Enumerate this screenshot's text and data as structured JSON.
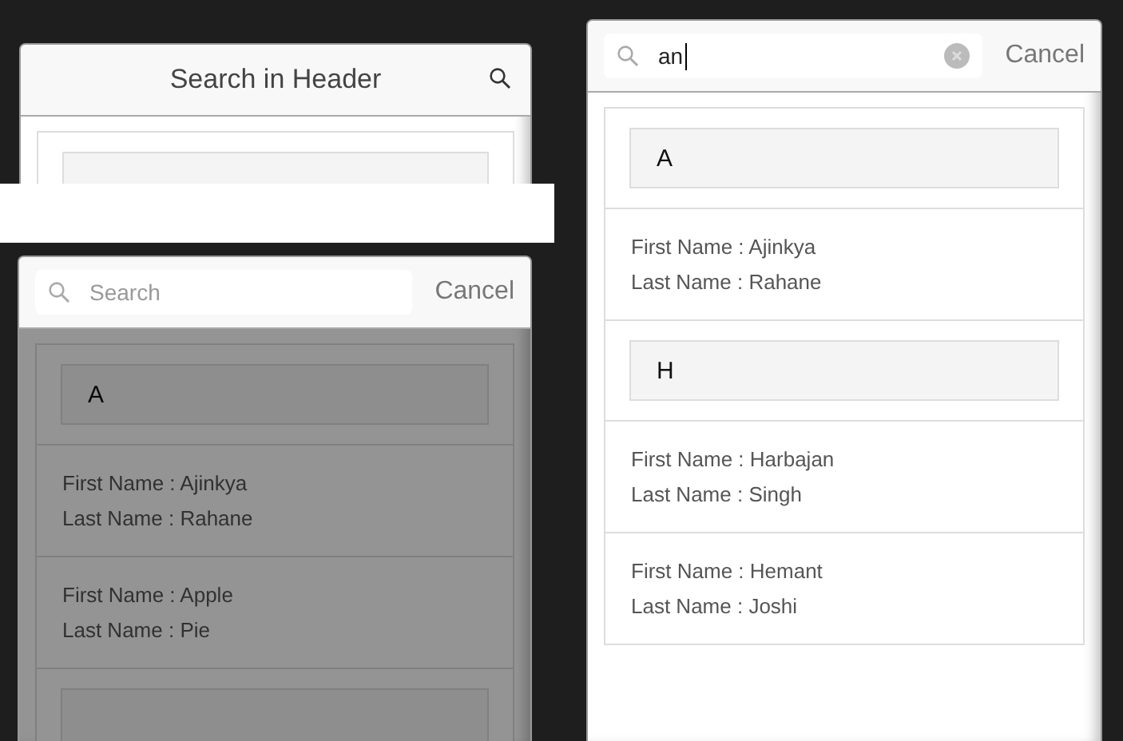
{
  "panels": [
    {
      "kind": "header",
      "title": "Search in Header",
      "list": [
        {
          "kind": "divider"
        }
      ]
    },
    {
      "kind": "search",
      "search": {
        "placeholder": "Search",
        "focused": false
      },
      "cancel": "Cancel",
      "dimmed": true,
      "list": [
        {
          "kind": "divider",
          "label": "A"
        },
        {
          "kind": "person",
          "first": "First Name : Ajinkya",
          "last": "Last Name : Rahane"
        },
        {
          "kind": "person",
          "first": "First Name : Apple",
          "last": "Last Name : Pie"
        },
        {
          "kind": "divider"
        }
      ]
    },
    {
      "kind": "search",
      "search": {
        "value": "an",
        "focused": true
      },
      "cancel": "Cancel",
      "dimmed": false,
      "list": [
        {
          "kind": "divider",
          "label": "A"
        },
        {
          "kind": "person",
          "first": "First Name : Ajinkya",
          "last": "Last Name : Rahane"
        },
        {
          "kind": "divider",
          "label": "H"
        },
        {
          "kind": "person",
          "first": "First Name : Harbajan",
          "last": "Last Name : Singh"
        },
        {
          "kind": "person",
          "first": "First Name : Hemant",
          "last": "Last Name : Joshi"
        }
      ]
    }
  ]
}
